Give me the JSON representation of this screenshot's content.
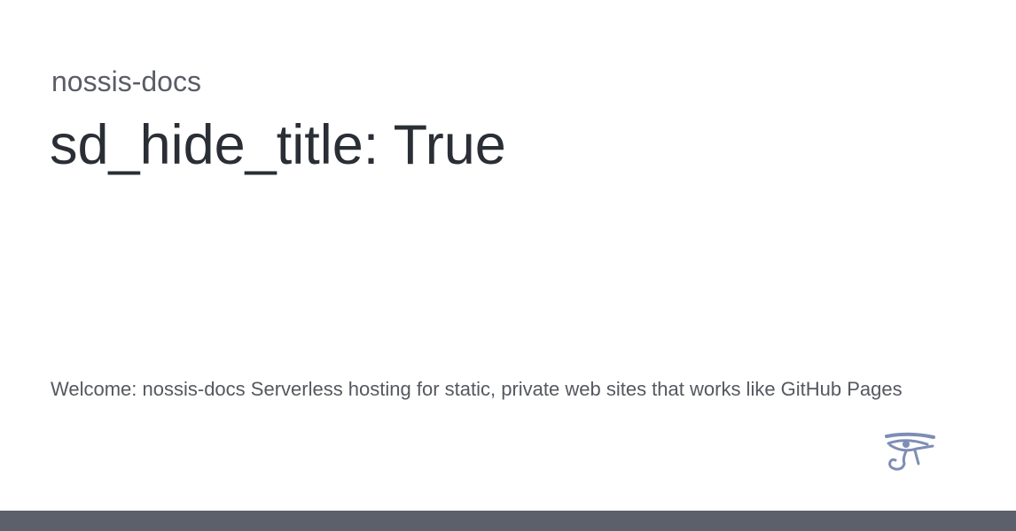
{
  "site": {
    "name": "nossis-docs"
  },
  "page": {
    "title": "sd_hide_title: True",
    "description": "Welcome: nossis-docs Serverless hosting for static, private web sites that works like GitHub Pages"
  },
  "logo": {
    "icon": "eye-of-horus-icon"
  },
  "colors": {
    "footer_bar": "#5b606b",
    "logo": "#7e8db5",
    "title": "#2a2e35",
    "site_name": "#5a5d66",
    "description": "#55585f"
  }
}
